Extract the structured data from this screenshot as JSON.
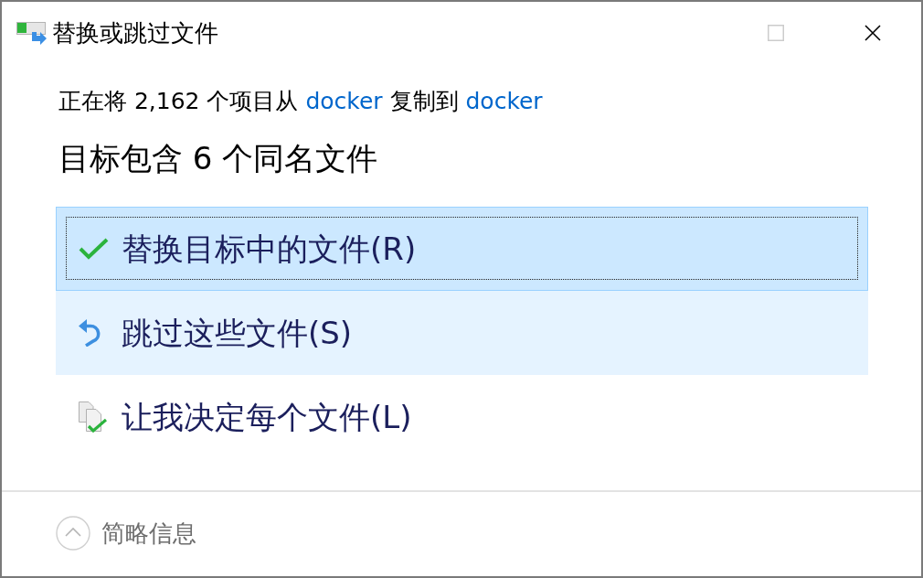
{
  "window": {
    "title": "替换或跳过文件",
    "controls": [
      {
        "kind": "maximize",
        "disabled": true
      },
      {
        "kind": "close",
        "disabled": false
      }
    ]
  },
  "message": {
    "parts": [
      {
        "kind": "text",
        "text": "正在将 2,162 个项目从 "
      },
      {
        "kind": "link",
        "text": "docker"
      },
      {
        "kind": "text",
        "text": " 复制到 "
      },
      {
        "kind": "link",
        "text": "docker"
      }
    ]
  },
  "heading": "目标包含 6 个同名文件",
  "options": [
    {
      "kind": "replace",
      "label": "替换目标中的文件(R)",
      "selected": true,
      "hovered": false,
      "focused": true
    },
    {
      "kind": "skip",
      "label": "跳过这些文件(S)",
      "selected": false,
      "hovered": true,
      "focused": false
    },
    {
      "kind": "decide",
      "label": "让我决定每个文件(L)",
      "selected": false,
      "hovered": false,
      "focused": false
    }
  ],
  "details_toggle": {
    "label": "简略信息",
    "expanded": true
  }
}
